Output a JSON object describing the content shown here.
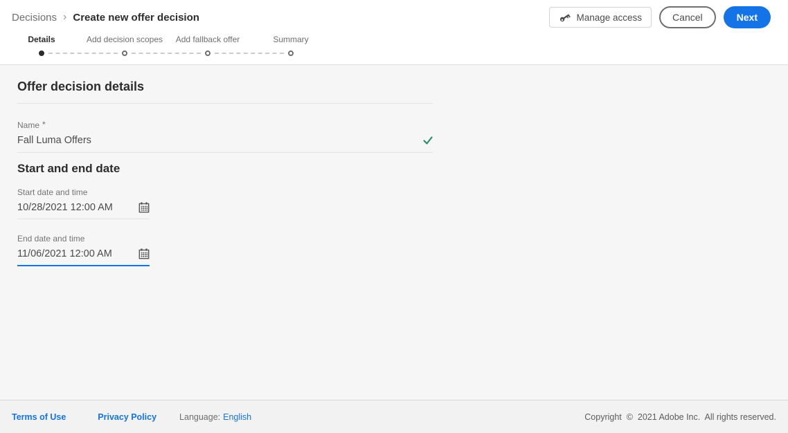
{
  "breadcrumb": {
    "parent": "Decisions",
    "separator": "›",
    "current": "Create new offer decision"
  },
  "actions": {
    "manage_access": "Manage access",
    "cancel": "Cancel",
    "next": "Next"
  },
  "steps": [
    {
      "label": "Details",
      "state": "active"
    },
    {
      "label": "Add decision scopes",
      "state": "upcoming"
    },
    {
      "label": "Add fallback offer",
      "state": "upcoming"
    },
    {
      "label": "Summary",
      "state": "upcoming"
    }
  ],
  "details_section": {
    "title": "Offer decision details",
    "name": {
      "label": "Name",
      "required_marker": "*",
      "value": "Fall Luma Offers"
    }
  },
  "dates_section": {
    "title": "Start and end date",
    "start": {
      "label": "Start date and time",
      "value": "10/28/2021 12:00 AM"
    },
    "end": {
      "label": "End date and time",
      "value": "11/06/2021 12:00 AM"
    }
  },
  "footer": {
    "terms": "Terms of Use",
    "privacy": "Privacy Policy",
    "language_label": "Language:",
    "language_value": "English",
    "copyright": "Copyright  ©  2021 Adobe Inc.  All rights reserved."
  },
  "colors": {
    "accent_blue": "#1473e6",
    "success_green": "#268e6c",
    "link_blue": "#1473e6",
    "active_step": "#2c2c2c"
  }
}
